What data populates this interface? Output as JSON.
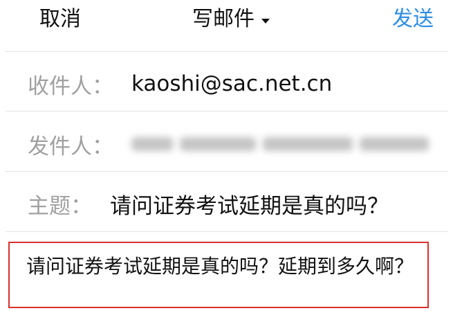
{
  "header": {
    "cancel_label": "取消",
    "title": "写邮件",
    "send_label": "发送",
    "send_color": "#2f8de4",
    "title_icon": "caret-down-icon"
  },
  "recipient": {
    "label": "收件人：",
    "value": "kaoshi@sac.net.cn"
  },
  "sender": {
    "label": "发件人：",
    "value_blurred": true
  },
  "subject": {
    "label": "主题：",
    "value": "请问证券考试延期是真的吗？"
  },
  "body": {
    "text": "请问证券考试延期是真的吗？延期到多久啊？",
    "highlight_color": "#d9302c"
  }
}
